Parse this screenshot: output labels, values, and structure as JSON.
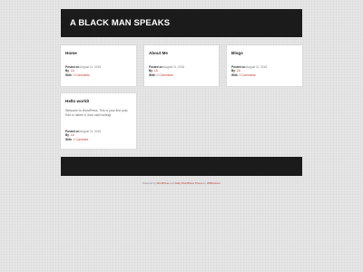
{
  "site": {
    "title": "A BLACK MAN SPEAKS"
  },
  "posts": [
    {
      "title": "Home",
      "excerpt": "",
      "meta": {
        "posted_on_label": "Posted on",
        "date": "August 11, 2016",
        "by_label": "By",
        "author": "LA",
        "with_label": "With",
        "comments": "0 Comments"
      }
    },
    {
      "title": "About Me",
      "excerpt": "",
      "meta": {
        "posted_on_label": "Posted on",
        "date": "August 11, 2016",
        "by_label": "By",
        "author": "LA",
        "with_label": "With",
        "comments": "0 Comments"
      }
    },
    {
      "title": "Blogs",
      "excerpt": "",
      "meta": {
        "posted_on_label": "Posted on",
        "date": "August 11, 2016",
        "by_label": "By",
        "author": "LA",
        "with_label": "With",
        "comments": "0 Comments"
      }
    },
    {
      "title": "Hello world!",
      "excerpt": "Welcome to WordPress. This is your first post. Edit or delete it, then start writing!",
      "meta": {
        "posted_on_label": "Posted on",
        "date": "August 11, 2016",
        "by_label": "By",
        "author": "LA",
        "with_label": "With",
        "comments": "1 Comment"
      }
    }
  ],
  "footer": {
    "credit_prefix": "Powered by",
    "wordpress_link": "WordPress",
    "credit_middle": "and",
    "theme_link": "Flatty WordPress Theme",
    "credit_by": "by",
    "author_link": "WPExplorer"
  },
  "colors": {
    "header_bg": "#1b1b1b",
    "link": "#c0392b",
    "page_bg": "#e6e6e6"
  }
}
